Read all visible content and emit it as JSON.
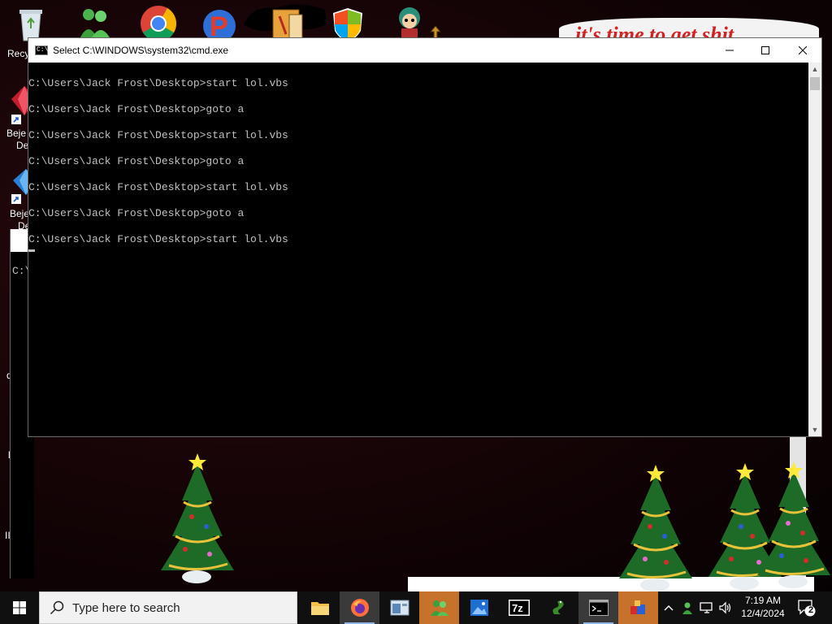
{
  "desktop": {
    "labels": {
      "recycle": "Recy",
      "bejeweled1_a": "Beje",
      "bejeweled1_b": "De",
      "bejeweled2_a": "Beje",
      "bejeweled2_b": "De",
      "bg_cmd_text": "C:\\",
      "frag_d": "d",
      "frag_l": "l",
      "frag_iii": "III"
    },
    "banner_text": "it's time to get shit"
  },
  "cmd_window": {
    "title": "Select C:\\WINDOWS\\system32\\cmd.exe",
    "icon_text": "C:\\",
    "lines": [
      "C:\\Users\\Jack Frost\\Desktop>start lol.vbs",
      "C:\\Users\\Jack Frost\\Desktop>goto a",
      "C:\\Users\\Jack Frost\\Desktop>start lol.vbs",
      "C:\\Users\\Jack Frost\\Desktop>goto a",
      "C:\\Users\\Jack Frost\\Desktop>start lol.vbs",
      "C:\\Users\\Jack Frost\\Desktop>goto a",
      "C:\\Users\\Jack Frost\\Desktop>start lol.vbs"
    ]
  },
  "taskbar": {
    "search_placeholder": "Type here to search",
    "sevenzip_label": "7z",
    "clock_time": "7:19 AM",
    "clock_date": "12/4/2024",
    "notification_count": "2"
  },
  "colors": {
    "accent": "#0078d4",
    "console_text": "#c0c0c0",
    "banner_text": "#d32222"
  }
}
